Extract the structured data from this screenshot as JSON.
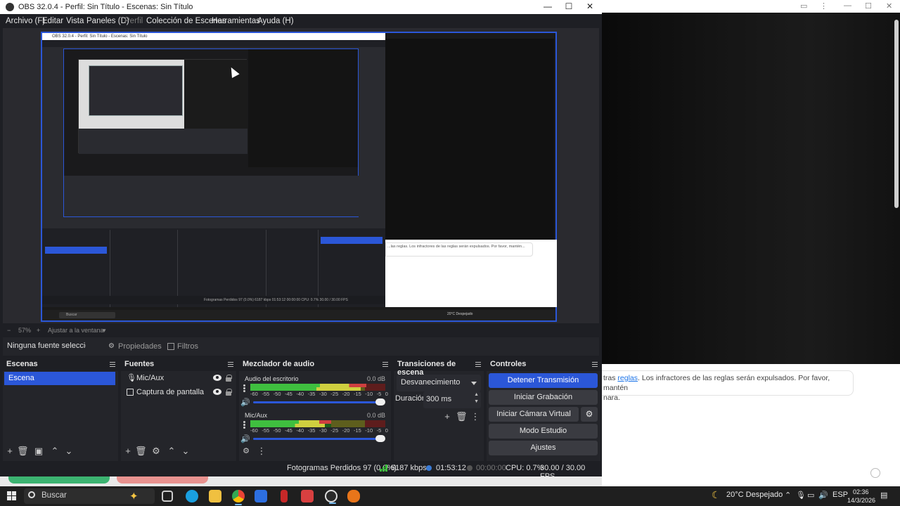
{
  "window": {
    "title": "OBS 32.0.4 - Perfil: Sin Título - Escenas: Sin Título",
    "minimize_glyph": "—",
    "maximize_glyph": "☐",
    "close_glyph": "✕"
  },
  "menu": {
    "items": [
      "Archivo (F)",
      "Editar",
      "Vista",
      "Paneles (D)",
      "Perfil",
      "Colección de Escenas",
      "Herramientas",
      "Ayuda (H)"
    ]
  },
  "preview": {
    "zoom": "57%",
    "zoom_mode": "Ajustar a la ventana",
    "nested_chat_text": "...las reglas. Los infractores de las reglas serán expulsados. Por favor, mantén...",
    "nested_taskbar_search": "Buscar",
    "nested_weather": "20°C  Despejado",
    "nested_status": "Fotogramas Perdidos 97 (0.0%)   6187 kbps   01:53:12   00:00:00   CPU: 0.7%   30.00 / 30.00 FPS"
  },
  "context_bar": {
    "no_source": "Ninguna fuente seleccionada",
    "properties": "Propiedades",
    "filters": "Filtros"
  },
  "scenes": {
    "title": "Escenas",
    "items": [
      "Escena"
    ]
  },
  "sources": {
    "title": "Fuentes",
    "items": [
      {
        "label": "Mic/Aux",
        "icon": "microphone-icon"
      },
      {
        "label": "Captura de pantalla",
        "icon": "monitor-icon"
      }
    ]
  },
  "mixer": {
    "title": "Mezclador de audio",
    "ticks": [
      "-60",
      "-55",
      "-50",
      "-45",
      "-40",
      "-35",
      "-30",
      "-25",
      "-20",
      "-15",
      "-10",
      "-5",
      "0"
    ],
    "channels": [
      {
        "name": "Audio del escritorio",
        "db": "0.0 dB",
        "level_a": 0.86,
        "level_b": 0.82
      },
      {
        "name": "Mic/Aux",
        "db": "0.0 dB",
        "level_a": 0.6,
        "level_b": 0.55
      }
    ]
  },
  "transitions": {
    "title": "Transiciones de escena",
    "selected": "Desvanecimiento",
    "duration_label": "Duración",
    "duration_value": "300 ms"
  },
  "controls": {
    "title": "Controles",
    "stop_stream": "Detener Transmisión",
    "start_recording": "Iniciar Grabación",
    "start_virtual_cam": "Iniciar Cámara Virtual",
    "studio_mode": "Modo Estudio",
    "settings": "Ajustes"
  },
  "status": {
    "dropped_frames": "Fotogramas Perdidos 97 (0.0%)",
    "bitrate": "6187 kbps",
    "stream_time": "01:53:12",
    "record_time": "00:00:00",
    "cpu": "CPU: 0.7%",
    "fps": "30.00 / 30.00 FPS"
  },
  "background_chat": {
    "prefix": "tras ",
    "link": "reglas",
    "text": ". Los infractores de las reglas serán expulsados. Por favor, mantén",
    "line2": "nara."
  },
  "taskbar": {
    "search": "Buscar",
    "weather": "20°C  Despejado",
    "lang": "ESP",
    "time": "02:36",
    "date": "14/3/2026"
  },
  "colors": {
    "accent": "#2b57d8",
    "obs_bg": "#24252a",
    "meter_green": "#3fbf3f"
  }
}
